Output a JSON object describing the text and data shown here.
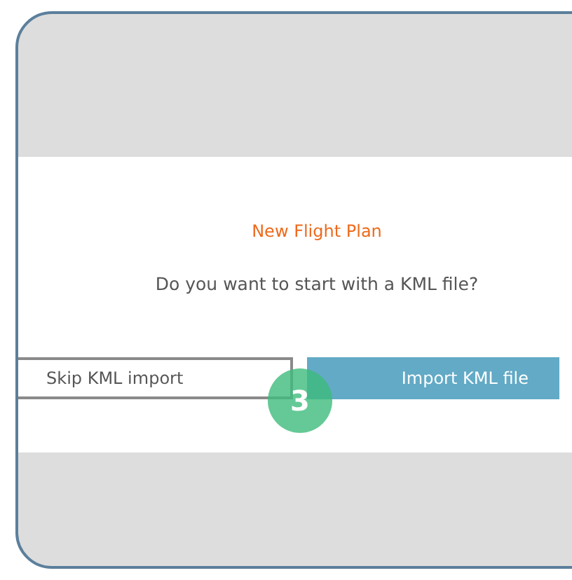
{
  "dialog": {
    "title": "New Flight Plan",
    "message": "Do you want to start with a KML file?",
    "buttons": [
      {
        "label": "Skip KML import",
        "kind": "secondary"
      },
      {
        "label": "Import KML file",
        "kind": "primary"
      }
    ]
  },
  "step_badge": "3"
}
